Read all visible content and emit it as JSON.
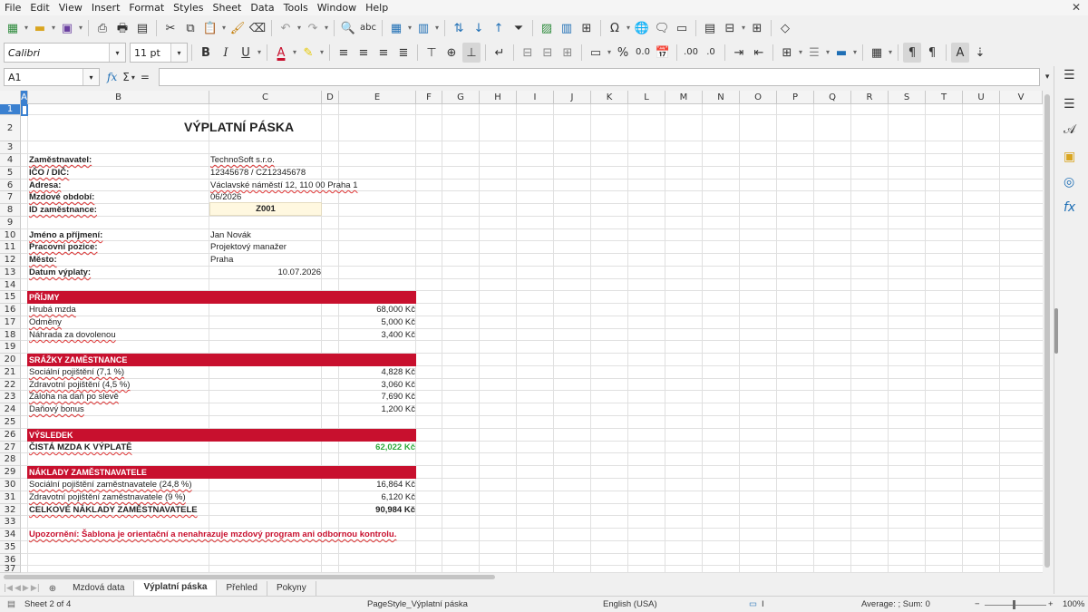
{
  "menubar": {
    "items": [
      "File",
      "Edit",
      "View",
      "Insert",
      "Format",
      "Styles",
      "Sheet",
      "Data",
      "Tools",
      "Window",
      "Help"
    ],
    "close_label": "✕"
  },
  "toolbar2": {
    "font_name": "Calibri",
    "font_size": "11 pt",
    "bold": "B",
    "italic": "I",
    "underline": "U",
    "percent": "%",
    "decimal_zero": "0.0",
    "decimal_add": ".00"
  },
  "formula_bar": {
    "cell_ref": "A1",
    "fx": "fx",
    "sigma": "Σ",
    "equals": "="
  },
  "columns": [
    "A",
    "B",
    "C",
    "D",
    "E",
    "F",
    "G",
    "H",
    "I",
    "J",
    "K",
    "L",
    "M",
    "N",
    "O",
    "P",
    "Q",
    "R",
    "S",
    "T",
    "U",
    "V"
  ],
  "rows": [
    "1",
    "2",
    "3",
    "4",
    "5",
    "6",
    "7",
    "8",
    "9",
    "10",
    "11",
    "12",
    "13",
    "14",
    "15",
    "16",
    "17",
    "18",
    "19",
    "20",
    "21",
    "22",
    "23",
    "24",
    "25",
    "26",
    "27",
    "28",
    "29",
    "30",
    "31",
    "32",
    "33",
    "34",
    "35",
    "36",
    "37"
  ],
  "sheet": {
    "title": "VÝPLATNÍ PÁSKA",
    "employer_label": "Zaměstnavatel:",
    "employer_value": "TechnoSoft s.r.o.",
    "ico_label": "IČO / DIČ:",
    "ico_value": "12345678 / CZ12345678",
    "address_label": "Adresa:",
    "address_value": "Václavské náměstí 12, 110 00 Praha 1",
    "period_label": "Mzdové období:",
    "period_value": "06/2026",
    "id_label": "ID zaměstnance:",
    "id_value": "Z001",
    "name_label": "Jméno a příjmení:",
    "name_value": "Jan Novák",
    "position_label": "Pracovní pozice:",
    "position_value": "Projektový manažer",
    "city_label": "Město:",
    "city_value": "Praha",
    "paydate_label": "Datum výplaty:",
    "paydate_value": "10.07.2026",
    "income_header": "PŘÍJMY",
    "gross_label": "Hrubá mzda",
    "gross_value": "68,000 Kč",
    "bonus_label": "Odměny",
    "bonus_value": "5,000 Kč",
    "vacation_label": "Náhrada za dovolenou",
    "vacation_value": "3,400 Kč",
    "deductions_header": "SRÁŽKY ZAMĚSTNANCE",
    "social_label": "Sociální pojištění (7,1 %)",
    "social_value": "4,828 Kč",
    "health_label": "Zdravotní pojištění (4,5 %)",
    "health_value": "3,060 Kč",
    "tax_label": "Záloha na daň po slevě",
    "tax_value": "7,690 Kč",
    "taxbonus_label": "Daňový bonus",
    "taxbonus_value": "1,200 Kč",
    "result_header": "VÝSLEDEK",
    "net_label": "ČISTÁ MZDA K VÝPLATĚ",
    "net_value": "62,022 Kč",
    "employer_costs_header": "NÁKLADY ZAMĚSTNAVATELE",
    "emp_social_label": "Sociální pojištění zaměstnavatele (24,8 %)",
    "emp_social_value": "16,864 Kč",
    "emp_health_label": "Zdravotní pojištění zaměstnavatele (9 %)",
    "emp_health_value": "6,120 Kč",
    "total_cost_label": "CELKOVÉ NÁKLADY ZAMĚSTNAVATELE",
    "total_cost_value": "90,984 Kč",
    "warning": "Upozornění: Šablona je orientační a nenahrazuje mzdový program ani odbornou kontrolu."
  },
  "tabs": [
    "Mzdová data",
    "Výplatní páska",
    "Přehled",
    "Pokyny"
  ],
  "active_tab": "Výplatní páska",
  "status": {
    "sheet": "Sheet 2 of 4",
    "page_style": "PageStyle_Výplatní páska",
    "language": "English (USA)",
    "summary": "Average: ; Sum: 0",
    "zoom": "100%",
    "zoom_minus": "−",
    "zoom_plus": "+"
  },
  "colors": {
    "band": "#c8102e",
    "net_value": "#2eaa3c",
    "selection": "#3a80d0"
  }
}
